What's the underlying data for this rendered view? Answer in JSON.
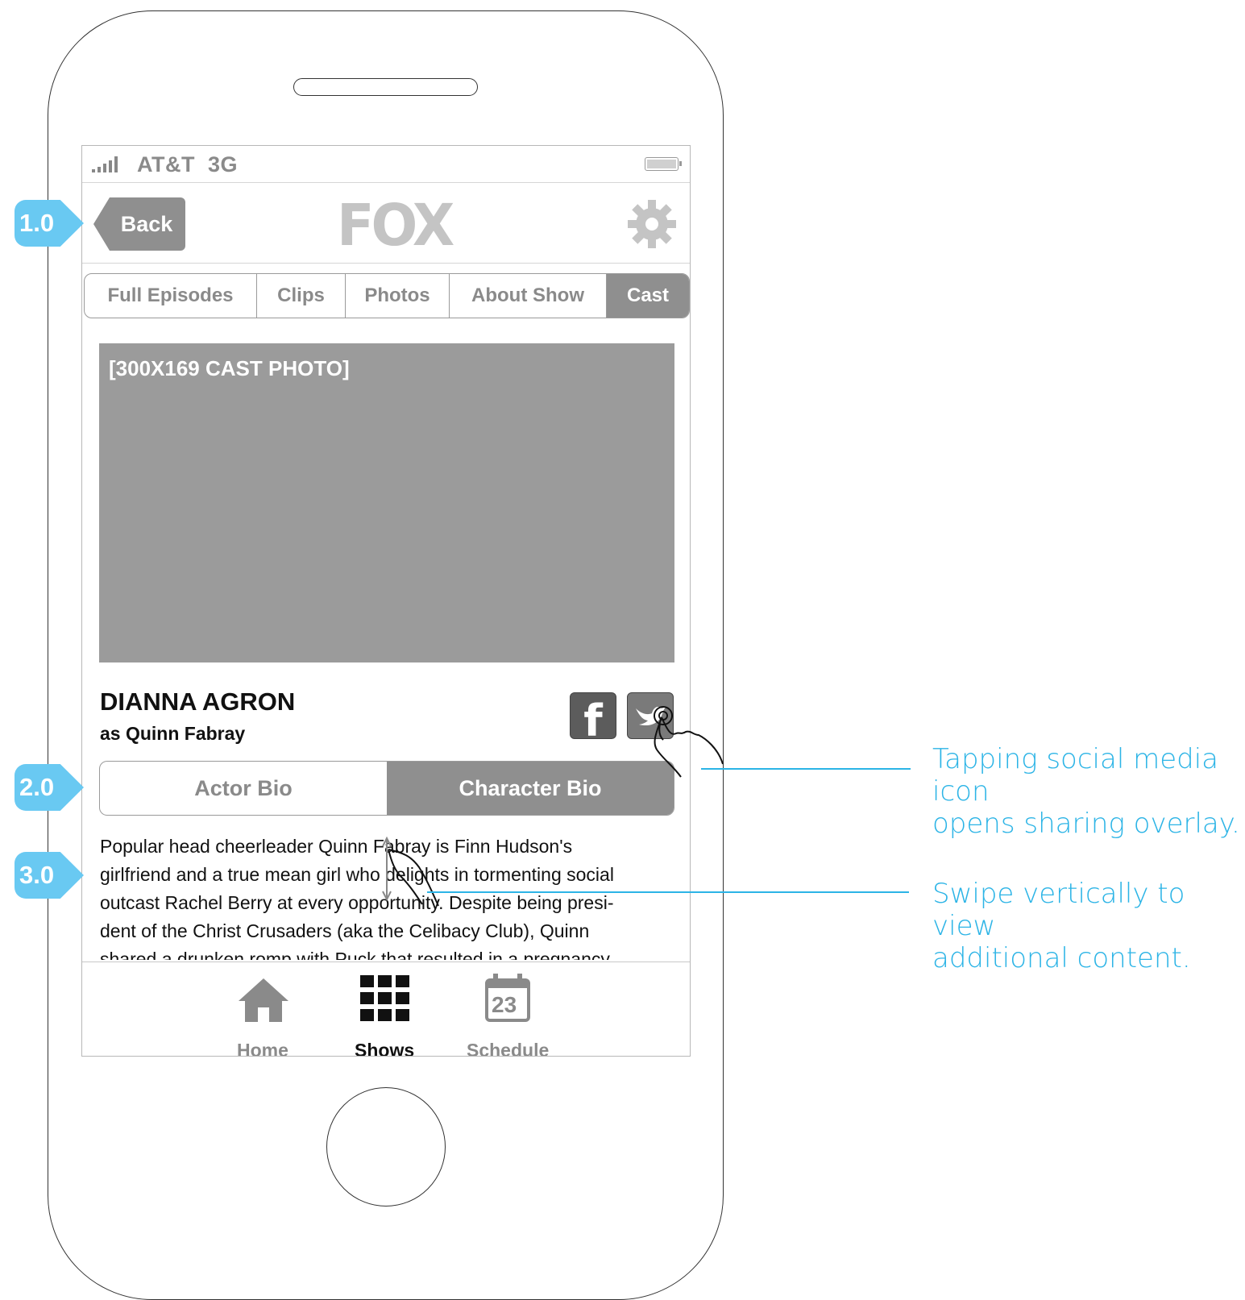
{
  "status_bar": {
    "carrier": "AT&T",
    "network": "3G"
  },
  "header": {
    "back_label": "Back",
    "logo": "FOX"
  },
  "tabs": [
    {
      "label": "Full Episodes",
      "active": false
    },
    {
      "label": "Clips",
      "active": false
    },
    {
      "label": "Photos",
      "active": false
    },
    {
      "label": "About Show",
      "active": false
    },
    {
      "label": "Cast",
      "active": true
    }
  ],
  "photo": {
    "placeholder": "[300X169 CAST PHOTO]"
  },
  "cast": {
    "name": "DIANNA AGRON",
    "role": "as Quinn Fabray"
  },
  "social": {
    "facebook_glyph": "f"
  },
  "bio_toggle": {
    "actor_label": "Actor Bio",
    "character_label": "Character Bio",
    "selected": "Character Bio"
  },
  "bio": {
    "lines": [
      "Popular head cheerleader Quinn Fabray is Finn Hudson's",
      "girlfriend and a true mean girl who delights in tormenting social",
      "outcast Rachel Berry at every opportunity. Despite being presi-",
      "dent of the Christ Crusaders (aka the Celibacy Club), Quinn",
      "shared a drunken romp with Puck that resulted in a pregnancy."
    ]
  },
  "tab_bar": {
    "items": [
      {
        "label": "Home",
        "icon": "home-icon",
        "active": false
      },
      {
        "label": "Shows",
        "icon": "grid-icon",
        "active": true
      },
      {
        "label": "Schedule",
        "icon": "calendar-icon",
        "active": false
      }
    ],
    "calendar_day": "23"
  },
  "annotations": {
    "badges": [
      "1.0",
      "2.0",
      "3.0"
    ],
    "notes": [
      {
        "line1": "Tapping social media icon",
        "line2": "opens sharing overlay."
      },
      {
        "line1": "Swipe vertically to view",
        "line2": "additional content."
      }
    ],
    "accent": "#2cb4e6",
    "badge_color": "#69c9f2"
  }
}
